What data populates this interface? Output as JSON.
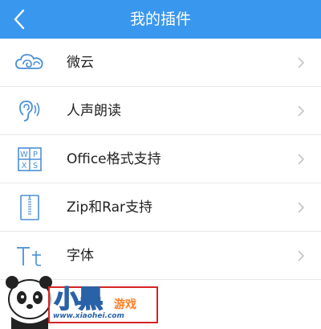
{
  "header": {
    "title": "我的插件",
    "back_icon": "chevron-left-icon",
    "background": "#3a97ee"
  },
  "plugins": [
    {
      "label": "微云",
      "icon": "cloud-icon"
    },
    {
      "label": "人声朗读",
      "icon": "ear-icon"
    },
    {
      "label": "Office格式支持",
      "icon": "office-formats-icon"
    },
    {
      "label": "Zip和Rar支持",
      "icon": "zip-file-icon"
    },
    {
      "label": "字体",
      "icon": "font-icon"
    }
  ],
  "watermark": {
    "logo_text": "小黑游戏",
    "url": "www.xiaohei.com",
    "sub_text": "游戏"
  },
  "colors": {
    "accent": "#3a97ee",
    "icon": "#4a8fd6",
    "divider": "#e9e9e9",
    "chevron": "#c4c4c4"
  }
}
